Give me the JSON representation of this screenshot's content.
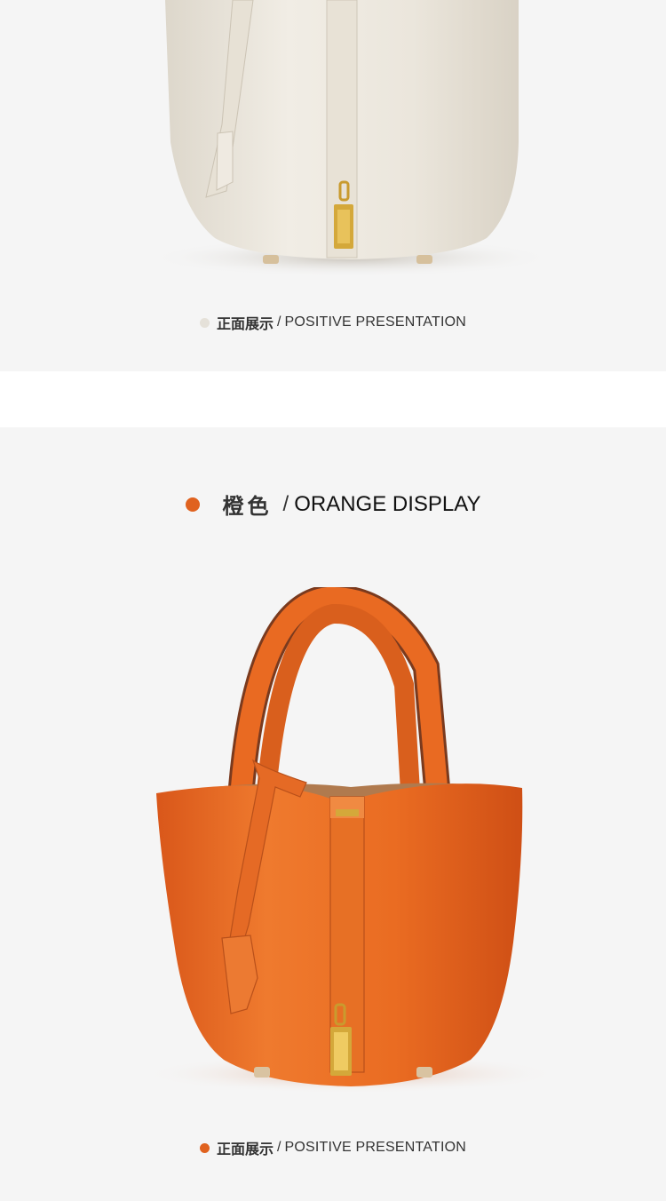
{
  "colors": {
    "background": "#f5f5f5",
    "white_bag": "#ebe6dc",
    "orange_bag": "#e96a22",
    "hardware_gold": "#d4a83a",
    "white_dot": "#e5e1d9",
    "orange_dot": "#e0621f"
  },
  "white_section": {
    "caption": {
      "cn": "正面展示",
      "sep": "/",
      "en": "POSITIVE PRESENTATION"
    }
  },
  "orange_section": {
    "heading": {
      "cn": "橙色",
      "sep": "/",
      "en": "ORANGE DISPLAY"
    },
    "caption": {
      "cn": "正面展示",
      "sep": "/",
      "en": "POSITIVE PRESENTATION"
    }
  }
}
